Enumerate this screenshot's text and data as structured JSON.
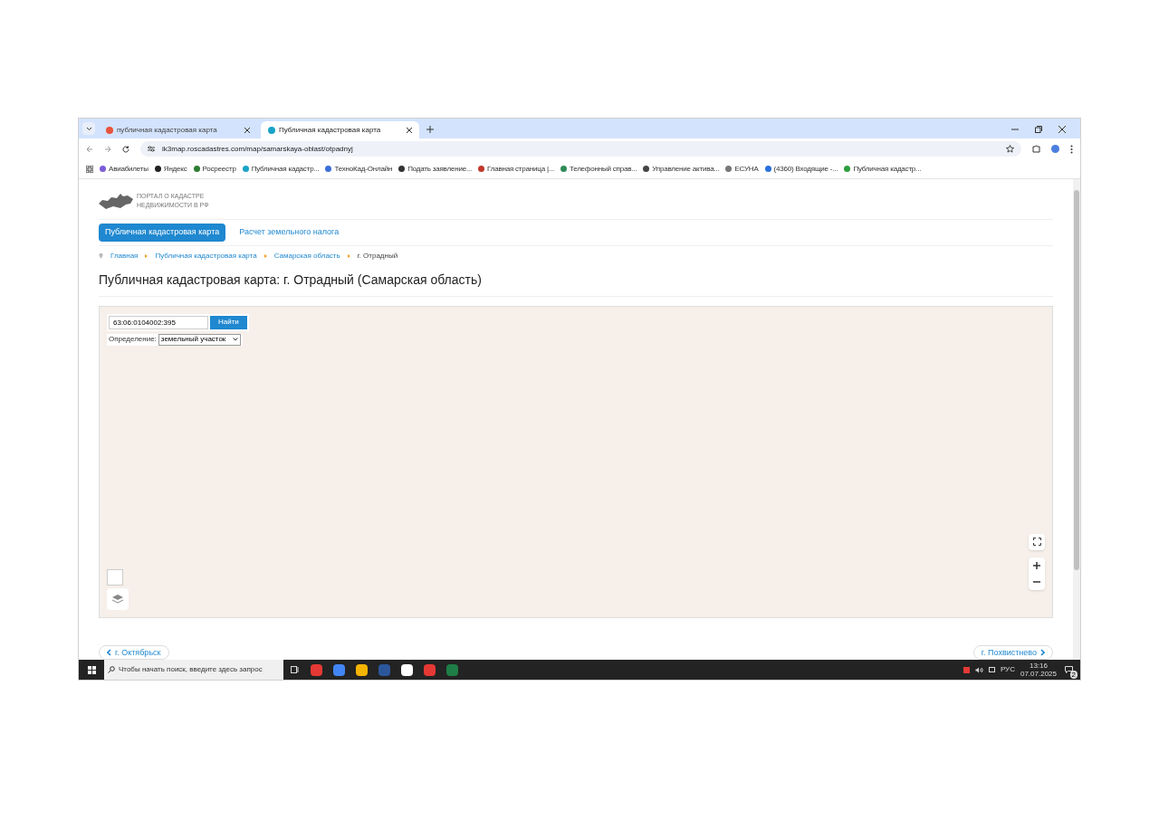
{
  "browser": {
    "tabs": [
      {
        "title": "публичная кадастровая карта",
        "selected": false
      },
      {
        "title": "Публичная кадастровая карта",
        "selected": true
      }
    ],
    "url": "ik3map.roscadastres.com/map/samarskaya-oblast/otpadnyj",
    "bookmarks": [
      "Авиабилеты",
      "Яндекс",
      "Росреестр",
      "Публичная кадастр...",
      "ТехноКад-Онлайн",
      "Подать заявление...",
      "Главная страница |...",
      "Телефонный справ...",
      "Управление актива...",
      "ЕСУНА",
      "(4360) Входящие -...",
      "Публичная кадастр..."
    ]
  },
  "page": {
    "logo_lines": [
      "ПОРТАЛ О КАДАСТРЕ",
      "НЕДВИЖИМОСТИ В РФ"
    ],
    "nav": [
      {
        "label": "Публичная кадастровая карта",
        "selected": true
      },
      {
        "label": "Расчет земельного налога",
        "selected": false
      }
    ],
    "breadcrumbs": [
      "Главная",
      "Публичная кадастровая карта",
      "Самарская область",
      "г. Отрадный"
    ],
    "title": "Публичная кадастровая карта: г. Отрадный (Самарская область)",
    "map": {
      "search_value": "63:06:0104002:395",
      "search_button": "Найти",
      "definition_label": "Определение:",
      "definition_value": "земельный участок"
    },
    "prev_link": "г. Октябрьск",
    "next_link": "г. Похвистнево"
  },
  "taskbar": {
    "search_placeholder": "Чтобы начать поиск, введите здесь запрос",
    "language": "РУС",
    "time": "13:16",
    "date": "07.07.2025",
    "notification_count": "2"
  }
}
